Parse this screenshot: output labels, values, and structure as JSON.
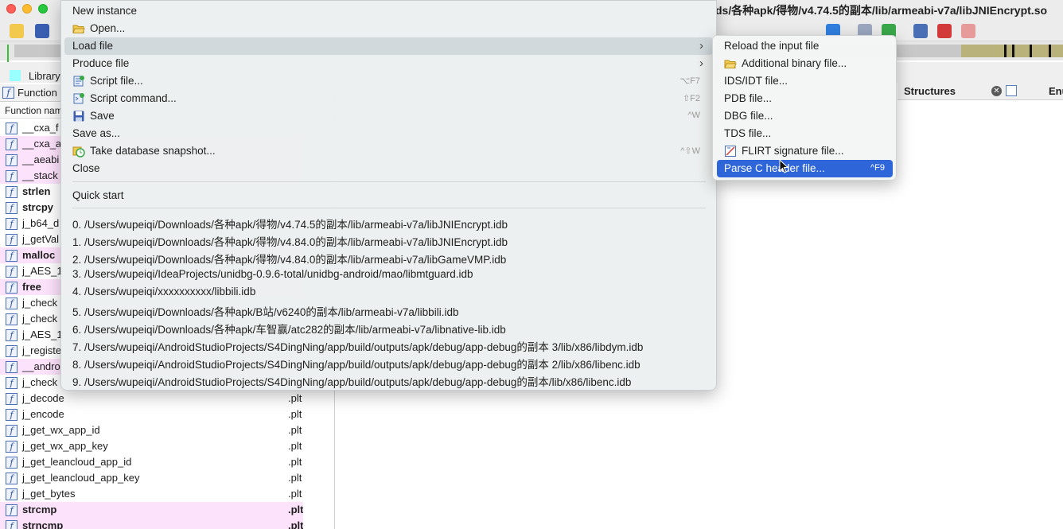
{
  "window": {
    "title": "ds/各种apk/得物/v4.74.5的副本/lib/armeabi-v7a/libJNIEncrypt.so"
  },
  "tabs": {
    "library": "Library"
  },
  "functions_panel": {
    "title": "Function",
    "column_header": "Function nam",
    "rows": [
      {
        "name": "__cxa_f",
        "segment": "",
        "bold": false,
        "pink": false
      },
      {
        "name": "__cxa_a",
        "segment": "",
        "bold": false,
        "pink": true
      },
      {
        "name": "__aeabi",
        "segment": "",
        "bold": false,
        "pink": true
      },
      {
        "name": "__stack",
        "segment": "",
        "bold": false,
        "pink": true
      },
      {
        "name": "strlen",
        "segment": "",
        "bold": true,
        "pink": false
      },
      {
        "name": "strcpy",
        "segment": "",
        "bold": true,
        "pink": false
      },
      {
        "name": "j_b64_d",
        "segment": "",
        "bold": false,
        "pink": false
      },
      {
        "name": "j_getVal",
        "segment": "",
        "bold": false,
        "pink": false
      },
      {
        "name": "malloc",
        "segment": "",
        "bold": true,
        "pink": true
      },
      {
        "name": "j_AES_1",
        "segment": "",
        "bold": false,
        "pink": false
      },
      {
        "name": "free",
        "segment": "",
        "bold": true,
        "pink": true
      },
      {
        "name": "j_check",
        "segment": "",
        "bold": false,
        "pink": false
      },
      {
        "name": "j_check",
        "segment": "",
        "bold": false,
        "pink": false
      },
      {
        "name": "j_AES_1",
        "segment": "",
        "bold": false,
        "pink": false
      },
      {
        "name": "j_registe",
        "segment": "",
        "bold": false,
        "pink": false
      },
      {
        "name": "__andro",
        "segment": "",
        "bold": false,
        "pink": true
      },
      {
        "name": "j_check",
        "segment": "",
        "bold": false,
        "pink": false
      },
      {
        "name": "j_decode",
        "segment": ".plt",
        "bold": false,
        "pink": false
      },
      {
        "name": "j_encode",
        "segment": ".plt",
        "bold": false,
        "pink": false
      },
      {
        "name": "j_get_wx_app_id",
        "segment": ".plt",
        "bold": false,
        "pink": false
      },
      {
        "name": "j_get_wx_app_key",
        "segment": ".plt",
        "bold": false,
        "pink": false
      },
      {
        "name": "j_get_leancloud_app_id",
        "segment": ".plt",
        "bold": false,
        "pink": false
      },
      {
        "name": "j_get_leancloud_app_key",
        "segment": ".plt",
        "bold": false,
        "pink": false
      },
      {
        "name": "j_get_bytes",
        "segment": ".plt",
        "bold": false,
        "pink": false
      },
      {
        "name": "strcmp",
        "segment": ".plt",
        "bold": true,
        "pink": true
      },
      {
        "name": "strncmp",
        "segment": ".plt",
        "bold": true,
        "pink": true
      }
    ]
  },
  "structures_tab": {
    "label": "Structures",
    "next_label": "Enu"
  },
  "file_menu": {
    "items": [
      {
        "label": "New instance",
        "icon": "",
        "shortcut": "",
        "submenu": false
      },
      {
        "label": "Open...",
        "icon": "folder-open-icon",
        "shortcut": "",
        "submenu": false
      },
      {
        "label": "Load file",
        "icon": "",
        "shortcut": "",
        "submenu": true
      },
      {
        "label": "Produce file",
        "icon": "",
        "shortcut": "",
        "submenu": true
      },
      {
        "label": "Script file...",
        "icon": "script-icon",
        "shortcut": "⌥F7",
        "submenu": false
      },
      {
        "label": "Script command...",
        "icon": "script-command-icon",
        "shortcut": "⇧F2",
        "submenu": false
      },
      {
        "label": "Save",
        "icon": "save-icon",
        "shortcut": "^W",
        "submenu": false
      },
      {
        "label": "Save as...",
        "icon": "",
        "shortcut": "",
        "submenu": false
      },
      {
        "label": "Take database snapshot...",
        "icon": "snapshot-icon",
        "shortcut": "^⇧W",
        "submenu": false
      },
      {
        "label": "Close",
        "icon": "",
        "shortcut": "",
        "submenu": false
      }
    ],
    "quick_start": "Quick start",
    "recent_files": [
      "0. /Users/wupeiqi/Downloads/各种apk/得物/v4.74.5的副本/lib/armeabi-v7a/libJNIEncrypt.idb",
      "1. /Users/wupeiqi/Downloads/各种apk/得物/v4.84.0的副本/lib/armeabi-v7a/libJNIEncrypt.idb",
      "2. /Users/wupeiqi/Downloads/各种apk/得物/v4.84.0的副本/lib/armeabi-v7a/libGameVMP.idb",
      "3. /Users/wupeiqi/IdeaProjects/unidbg-0.9.6-total/unidbg-android/mao/libmtguard.idb",
      "4. /Users/wupeiqi/xxxxxxxxxx/libbili.idb",
      "5. /Users/wupeiqi/Downloads/各种apk/B站/v6240的副本/lib/armeabi-v7a/libbili.idb",
      "6. /Users/wupeiqi/Downloads/各种apk/车智赢/atc282的副本/lib/armeabi-v7a/libnative-lib.idb",
      "7. /Users/wupeiqi/AndroidStudioProjects/S4DingNing/app/build/outputs/apk/debug/app-debug的副本 3/lib/x86/libdym.idb",
      "8. /Users/wupeiqi/AndroidStudioProjects/S4DingNing/app/build/outputs/apk/debug/app-debug的副本 2/lib/x86/libenc.idb",
      "9. /Users/wupeiqi/AndroidStudioProjects/S4DingNing/app/build/outputs/apk/debug/app-debug的副本/lib/x86/libenc.idb"
    ]
  },
  "load_file_submenu": {
    "items": [
      {
        "label": "Reload the input file",
        "icon": "",
        "shortcut": "",
        "active": false
      },
      {
        "label": "Additional binary file...",
        "icon": "folder-open-icon",
        "shortcut": "",
        "active": false
      },
      {
        "label": "IDS/IDT file...",
        "icon": "",
        "shortcut": "",
        "active": false
      },
      {
        "label": "PDB file...",
        "icon": "",
        "shortcut": "",
        "active": false
      },
      {
        "label": "DBG file...",
        "icon": "",
        "shortcut": "",
        "active": false
      },
      {
        "label": "TDS file...",
        "icon": "",
        "shortcut": "",
        "active": false
      },
      {
        "label": "FLIRT signature file...",
        "icon": "flirt-icon",
        "shortcut": "",
        "active": false
      },
      {
        "label": "Parse C header file...",
        "icon": "",
        "shortcut": "^F9",
        "active": true
      }
    ]
  },
  "colors": {
    "menu_highlight": "#2e66d9",
    "pink_row": "#fde2fb",
    "library_swatch": "#99ffff"
  }
}
